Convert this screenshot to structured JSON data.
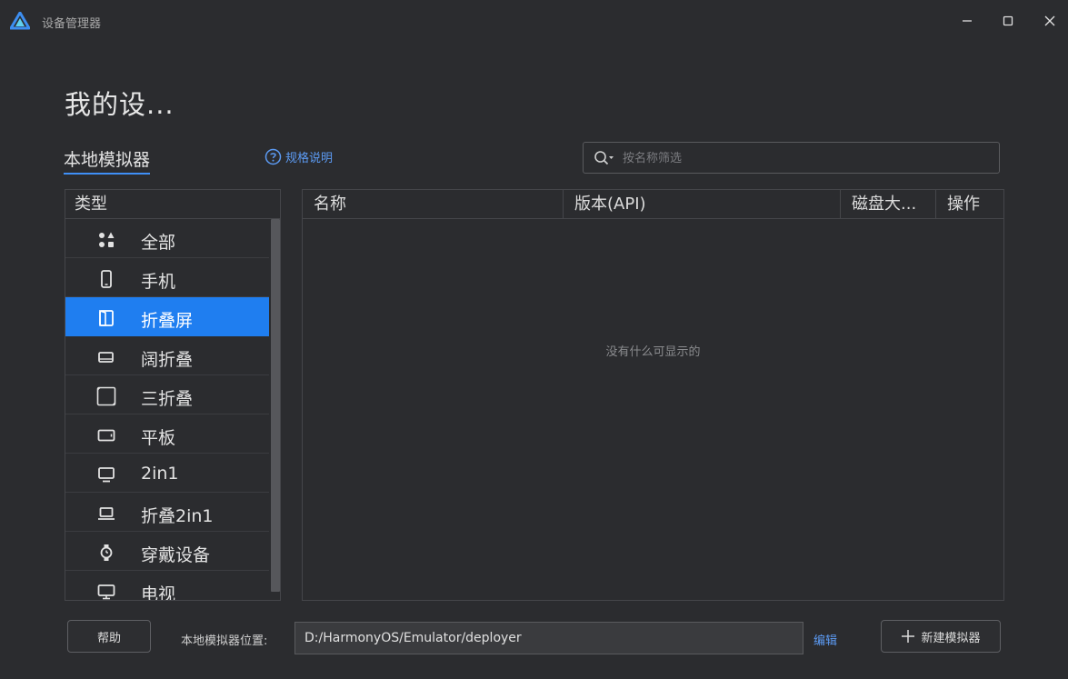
{
  "window": {
    "title": "设备管理器",
    "controls": [
      "minimize-icon",
      "maximize-icon",
      "close-icon"
    ]
  },
  "page": {
    "title": "我的设..."
  },
  "tabs": {
    "local_label": "本地模拟器"
  },
  "spec_link": {
    "label": "规格说明",
    "icon": "help-circle-icon"
  },
  "search": {
    "placeholder": "按名称筛选",
    "value": ""
  },
  "categories": {
    "header": "类型",
    "items": [
      {
        "label": "全部",
        "icon": "all-apps-icon"
      },
      {
        "label": "手机",
        "icon": "phone-icon"
      },
      {
        "label": "折叠屏",
        "icon": "foldable-icon",
        "selected": true
      },
      {
        "label": "阔折叠",
        "icon": "wide-fold-icon"
      },
      {
        "label": "三折叠",
        "icon": "tri-fold-icon"
      },
      {
        "label": "平板",
        "icon": "tablet-icon"
      },
      {
        "label": "2in1",
        "icon": "monitor-icon"
      },
      {
        "label": "折叠2in1",
        "icon": "laptop-icon"
      },
      {
        "label": "穿戴设备",
        "icon": "watch-icon"
      },
      {
        "label": "电视",
        "icon": "tv-icon"
      }
    ]
  },
  "table": {
    "columns": [
      "名称",
      "版本(API)",
      "磁盘大...",
      "操作"
    ],
    "empty_message": "没有什么可显示的"
  },
  "footer": {
    "help_label": "帮助",
    "path_label": "本地模拟器位置:",
    "path_value": "D:/HarmonyOS/Emulator/deployer",
    "edit_label": "编辑",
    "new_label": "新建模拟器"
  },
  "colors": {
    "background": "#2b2c2f",
    "accent": "#1f7ef0",
    "link": "#5c9bf4",
    "border": "#45464a"
  }
}
